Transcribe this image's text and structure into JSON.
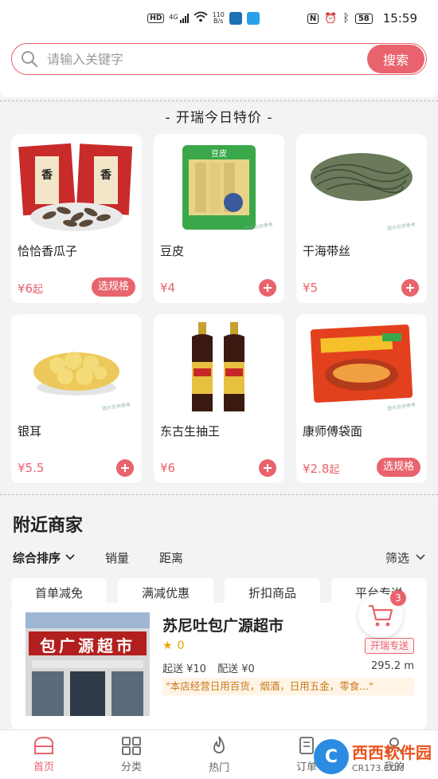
{
  "status_bar": {
    "hd_label": "HD",
    "net_label": "4G",
    "speed_value": "110",
    "speed_unit": "B/s",
    "battery": "58",
    "time": "15:59"
  },
  "search": {
    "placeholder": "请输入关键字",
    "button_label": "搜索"
  },
  "special": {
    "title": "- 开瑞今日特价 -",
    "products": [
      {
        "name": "恰恰香瓜子",
        "price": "¥6",
        "suffix": "起",
        "action": "选规格",
        "action_type": "spec"
      },
      {
        "name": "豆皮",
        "price": "¥4",
        "suffix": "",
        "action": "+",
        "action_type": "add"
      },
      {
        "name": "干海带丝",
        "price": "¥5",
        "suffix": "",
        "action": "+",
        "action_type": "add"
      },
      {
        "name": "银耳",
        "price": "¥5.5",
        "suffix": "",
        "action": "+",
        "action_type": "add"
      },
      {
        "name": "东古生抽王",
        "price": "¥6",
        "suffix": "",
        "action": "+",
        "action_type": "add"
      },
      {
        "name": "康师傅袋面",
        "price": "¥2.8",
        "suffix": "起",
        "action": "选规格",
        "action_type": "spec"
      }
    ]
  },
  "nearby": {
    "title": "附近商家",
    "sort": {
      "active": "综合排序",
      "sales": "销量",
      "distance": "距离",
      "filter": "筛选"
    },
    "tags": [
      "首单减免",
      "满减优惠",
      "折扣商品",
      "平台专送"
    ],
    "store": {
      "name": "苏尼吐包广源超市",
      "rating": "0",
      "min_order": "起送 ¥10",
      "delivery_fee": "配送 ¥0",
      "distance": "295.2 m",
      "badge": "开瑞专送",
      "description": "\"本店经营日用百货，烟酒，日用五金，零食...\"",
      "sign_text": "包广源超市"
    }
  },
  "cart": {
    "count": "3"
  },
  "tabbar": {
    "items": [
      {
        "label": "首页",
        "icon": "home-icon",
        "active": true
      },
      {
        "label": "分类",
        "icon": "grid-icon",
        "active": false
      },
      {
        "label": "热门",
        "icon": "flame-icon",
        "active": false
      },
      {
        "label": "订单",
        "icon": "order-icon",
        "active": false
      },
      {
        "label": "我的",
        "icon": "user-icon",
        "active": false
      }
    ]
  },
  "watermark": {
    "site_name": "西西软件园",
    "site_url": "CR173.COM"
  },
  "colors": {
    "accent": "#e8636d",
    "background": "#f3f3f3"
  }
}
